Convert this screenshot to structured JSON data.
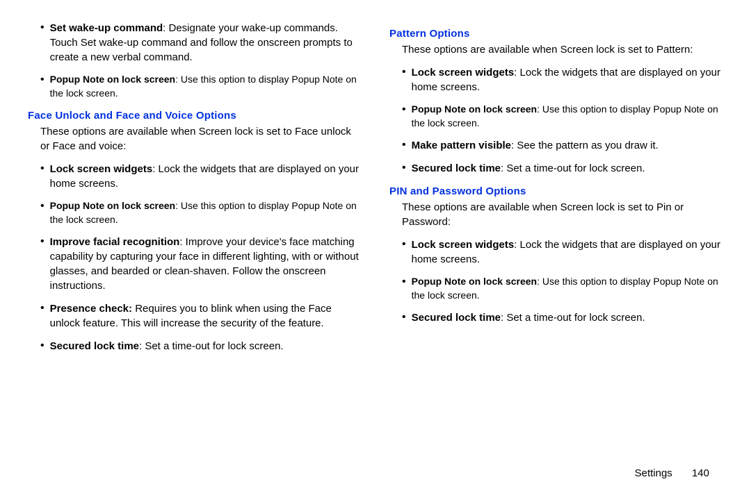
{
  "left": {
    "top_bullets": [
      {
        "bold": "Set wake-up command",
        "text": ": Designate your wake-up commands. Touch Set wake-up command and follow the onscreen prompts to create a new verbal command.",
        "small": false
      },
      {
        "bold": "Popup Note on lock screen",
        "text": ": Use this option to display Popup Note on the lock screen.",
        "small": true
      }
    ],
    "section_heading": "Face Unlock and Face and Voice Options",
    "section_intro": "These options are available when Screen lock is set to Face unlock or Face and voice:",
    "section_bullets": [
      {
        "bold": "Lock screen widgets",
        "text": ": Lock the widgets that are displayed on your home screens.",
        "small": false
      },
      {
        "bold": "Popup Note on lock screen",
        "text": ": Use this option to display Popup Note on the lock screen.",
        "small": true
      },
      {
        "bold": "Improve facial recognition",
        "text": ": Improve your device's face matching capability by capturing your face in different lighting, with or without glasses, and bearded or clean-shaven. Follow the onscreen instructions.",
        "small": false
      },
      {
        "bold": "Presence check:",
        "text": " Requires you to blink when using the Face unlock feature. This will increase the security of the feature.",
        "small": false
      },
      {
        "bold": "Secured lock time",
        "text": ": Set a time-out for lock screen.",
        "small": false
      }
    ]
  },
  "right": {
    "section1_heading": "Pattern Options",
    "section1_intro": "These options are available when Screen lock is set to Pattern:",
    "section1_bullets": [
      {
        "bold": "Lock screen widgets",
        "text": ": Lock the widgets that are displayed on your home screens.",
        "small": false
      },
      {
        "bold": "Popup Note on lock screen",
        "text": ": Use this option to display Popup Note on the lock screen.",
        "small": true
      },
      {
        "bold": "Make pattern visible",
        "text": ": See the pattern as you draw it.",
        "small": false
      },
      {
        "bold": "Secured lock time",
        "text": ": Set a time-out for lock screen.",
        "small": false
      }
    ],
    "section2_heading": "PIN and Password Options",
    "section2_intro": "These options are available when Screen lock is set to Pin or Password:",
    "section2_bullets": [
      {
        "bold": "Lock screen widgets",
        "text": ": Lock the widgets that are displayed on your home screens.",
        "small": false
      },
      {
        "bold": "Popup Note on lock screen",
        "text": ": Use this option to display Popup Note on the lock screen.",
        "small": true
      },
      {
        "bold": "Secured lock time",
        "text": ": Set a time-out for lock screen.",
        "small": false
      }
    ]
  },
  "footer": {
    "label": "Settings",
    "page": "140"
  }
}
